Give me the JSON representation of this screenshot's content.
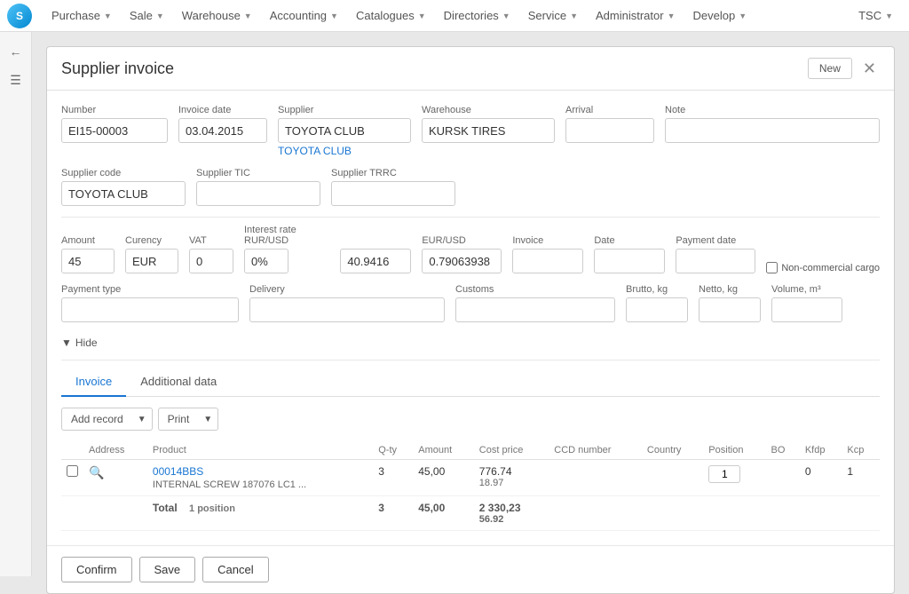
{
  "nav": {
    "logo": "S",
    "items": [
      {
        "label": "Purchase",
        "id": "purchase"
      },
      {
        "label": "Sale",
        "id": "sale"
      },
      {
        "label": "Warehouse",
        "id": "warehouse"
      },
      {
        "label": "Accounting",
        "id": "accounting"
      },
      {
        "label": "Catalogues",
        "id": "catalogues"
      },
      {
        "label": "Directories",
        "id": "directories"
      },
      {
        "label": "Service",
        "id": "service"
      },
      {
        "label": "Administrator",
        "id": "administrator"
      },
      {
        "label": "Develop",
        "id": "develop"
      }
    ],
    "user": "TSC"
  },
  "dialog": {
    "title": "Supplier invoice",
    "new_label": "New",
    "fields": {
      "number_label": "Number",
      "number_value": "EI15-00003",
      "invoice_date_label": "Invoice date",
      "invoice_date_value": "03.04.2015",
      "supplier_label": "Supplier",
      "supplier_value": "TOYOTA CLUB",
      "supplier_link": "TOYOTA CLUB",
      "warehouse_label": "Warehouse",
      "warehouse_value": "KURSK TIRES",
      "arrival_label": "Arrival",
      "arrival_value": "",
      "note_label": "Note",
      "note_value": "",
      "supplier_code_label": "Supplier code",
      "supplier_code_value": "TOYOTA CLUB",
      "supplier_tic_label": "Supplier TIC",
      "supplier_tic_value": "",
      "supplier_trrc_label": "Supplier TRRC",
      "supplier_trrc_value": "",
      "amount_label": "Amount",
      "amount_value": "45",
      "currency_label": "Curency",
      "currency_value": "EUR",
      "vat_label": "VAT",
      "vat_value": "0",
      "interest_rate_label": "Interest rate RUR/USD",
      "interest_rate_value": "0%",
      "eur_usd_label": "EUR/USD",
      "eur_usd_value": "0.79063938",
      "rur_usd_value": "40.9416",
      "invoice_label": "Invoice",
      "invoice_value": "",
      "date_label": "Date",
      "date_value": "",
      "payment_date_label": "Payment date",
      "payment_date_value": "",
      "non_commercial_label": "Non-commercial cargo",
      "payment_type_label": "Payment type",
      "payment_type_value": "",
      "delivery_label": "Delivery",
      "delivery_value": "",
      "customs_label": "Customs",
      "customs_value": "",
      "brutto_label": "Brutto, kg",
      "brutto_value": "",
      "netto_label": "Netto, kg",
      "netto_value": "",
      "volume_label": "Volume, m³",
      "volume_value": ""
    },
    "hide_label": "Hide",
    "tabs": [
      {
        "label": "Invoice",
        "active": true
      },
      {
        "label": "Additional data",
        "active": false
      }
    ],
    "toolbar": {
      "add_record_label": "Add record",
      "print_label": "Print"
    },
    "table": {
      "columns": [
        "Address",
        "Product",
        "Q-ty",
        "Amount",
        "Cost price",
        "CCD number",
        "Country",
        "Position",
        "BO",
        "Kfdp",
        "Kcp"
      ],
      "rows": [
        {
          "address": "",
          "product_link": "00014BBS",
          "product_name": "INTERNAL SCREW 187076 LC1 ...",
          "qty": "3",
          "amount": "45,00",
          "cost_price_1": "776.74",
          "cost_price_2": "18.97",
          "ccd_number": "",
          "country": "",
          "position": "1",
          "bo": "",
          "kfdp": "0",
          "kcp": "1"
        }
      ],
      "total_label": "Total",
      "total_position": "1 position",
      "total_qty": "3",
      "total_amount": "45,00",
      "total_cost_1": "2 330,23",
      "total_cost_2": "56.92"
    },
    "footer": {
      "confirm_label": "Confirm",
      "save_label": "Save",
      "cancel_label": "Cancel"
    }
  }
}
